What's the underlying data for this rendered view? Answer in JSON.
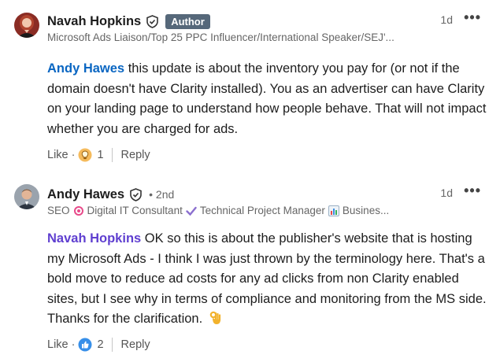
{
  "comments": [
    {
      "author": "Navah Hopkins",
      "badge": "Author",
      "headline": "Microsoft Ads Liaison/Top 25 PPC Influencer/International Speaker/SEJ'...",
      "time": "1d",
      "more_icon": "•••",
      "mention": "Andy Hawes",
      "text": " this update is about the inventory you pay for (or not if the domain doesn't have Clarity installed). You as an advertiser can have Clarity on your landing page to understand how people behave. That will not impact whether you are charged for ads.",
      "like_label": "Like",
      "reaction_icon": "insightful-reaction-icon",
      "reaction_count": "1",
      "reply_label": "Reply"
    },
    {
      "author": "Andy Hawes",
      "degree": "• 2nd",
      "headline_parts": [
        "SEO",
        "Digital IT Consultant",
        "Technical Project Manager",
        "Busines..."
      ],
      "time": "1d",
      "more_icon": "•••",
      "mention": "Navah Hopkins",
      "text": " OK so this is about the publisher's website that is hosting my Microsoft Ads - I think I was just thrown by the terminology here. That's a bold move to reduce ad costs for any ad clicks from non Clarity enabled sites, but I see why in terms of compliance and monitoring from the MS side. Thanks for the clarification.",
      "like_label": "Like",
      "reaction_icon": "like-reaction-icon",
      "reaction_count": "2",
      "reply_label": "Reply"
    }
  ],
  "dot": "·",
  "colors": {
    "link_blue": "#0a66c2",
    "mention_purple": "#5f3fd0",
    "badge_gray": "#56687a"
  }
}
